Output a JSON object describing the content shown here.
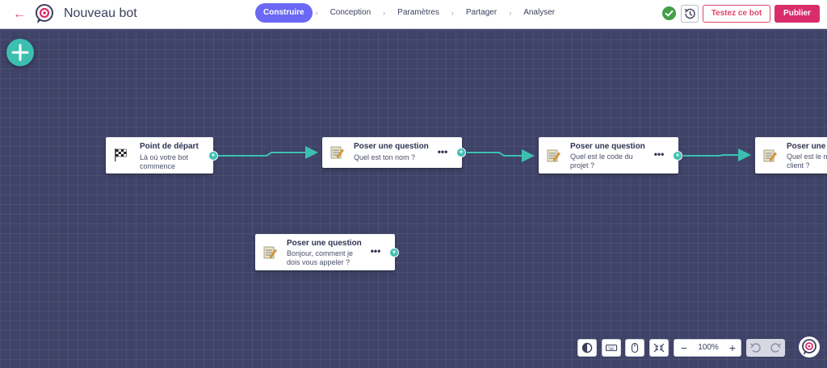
{
  "header": {
    "back_icon": "arrow-left-icon",
    "logo_icon": "bot-logo-icon",
    "title": "Nouveau bot",
    "steps": [
      {
        "label": "Construire",
        "active": true
      },
      {
        "label": "Conception",
        "active": false
      },
      {
        "label": "Paramètres",
        "active": false
      },
      {
        "label": "Partager",
        "active": false
      },
      {
        "label": "Analyser",
        "active": false
      }
    ],
    "separator": "›",
    "status_icon": "check-circle-icon",
    "history_icon": "history-icon",
    "test_label": "Testez ce bot",
    "publish_label": "Publier"
  },
  "canvas": {
    "add_icon": "plus-icon",
    "nodes": [
      {
        "type": "start",
        "icon": "checkered-flag-icon",
        "title": "Point de départ",
        "subtitle": "Là où votre bot\ncommence"
      },
      {
        "type": "question",
        "icon": "memo-icon",
        "title": "Poser une question",
        "subtitle": "Quel est ton nom ?",
        "menu": "•••"
      },
      {
        "type": "question",
        "icon": "memo-icon",
        "title": "Poser une question",
        "subtitle": "Quel est le code du\nprojet ?",
        "menu": "•••"
      },
      {
        "type": "question",
        "icon": "memo-icon",
        "title": "Poser une q",
        "subtitle": "Quel est le n\nclient ?"
      },
      {
        "type": "question",
        "icon": "memo-icon",
        "title": "Poser une question",
        "subtitle": "Bonjour, comment je\ndois vous appeler ?",
        "menu": "•••"
      }
    ],
    "port_symbol": "+"
  },
  "toolbar": {
    "contrast_icon": "contrast-icon",
    "keyboard_icon": "keyboard-icon",
    "mouse_icon": "mouse-icon",
    "fit_icon": "fit-screen-icon",
    "zoom_minus": "−",
    "zoom_value": "100%",
    "zoom_plus": "+",
    "undo_icon": "undo-icon",
    "redo_icon": "redo-icon",
    "chat_icon": "bot-chat-icon"
  },
  "colors": {
    "accent": "#6a68f5",
    "brand_pink": "#d92c6a",
    "teal": "#3cbfb0",
    "canvas": "#3f4368"
  }
}
